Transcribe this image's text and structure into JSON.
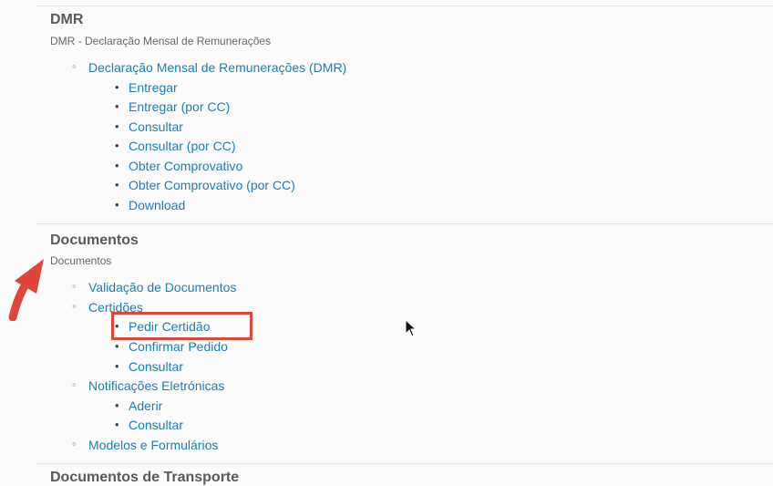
{
  "dmr": {
    "title": "DMR",
    "subtitle": "DMR - Declaração Mensal de Remunerações",
    "group": "Declaração Mensal de Remunerações (DMR)",
    "items": [
      "Entregar",
      "Entregar (por CC)",
      "Consultar",
      "Consultar (por CC)",
      "Obter Comprovativo",
      "Obter Comprovativo (por CC)",
      "Download"
    ]
  },
  "documentos": {
    "title": "Documentos",
    "subtitle": "Documentos",
    "validacao": "Validação de Documentos",
    "certidoes": {
      "label": "Certidões",
      "items": [
        "Pedir Certidão",
        "Confirmar Pedido",
        "Consultar"
      ]
    },
    "notificacoes": {
      "label": "Notificações Eletrónicas",
      "items": [
        "Aderir",
        "Consultar"
      ]
    },
    "modelos": "Modelos e Formulários"
  },
  "next_section": {
    "title": "Documentos de Transporte"
  },
  "colors": {
    "link": "#1a7fb3",
    "highlight": "#e0453a",
    "arrow": "#e0453a"
  },
  "icons": {
    "annotation_arrow": "arrow-up-right-icon",
    "cursor": "mouse-pointer-icon"
  }
}
